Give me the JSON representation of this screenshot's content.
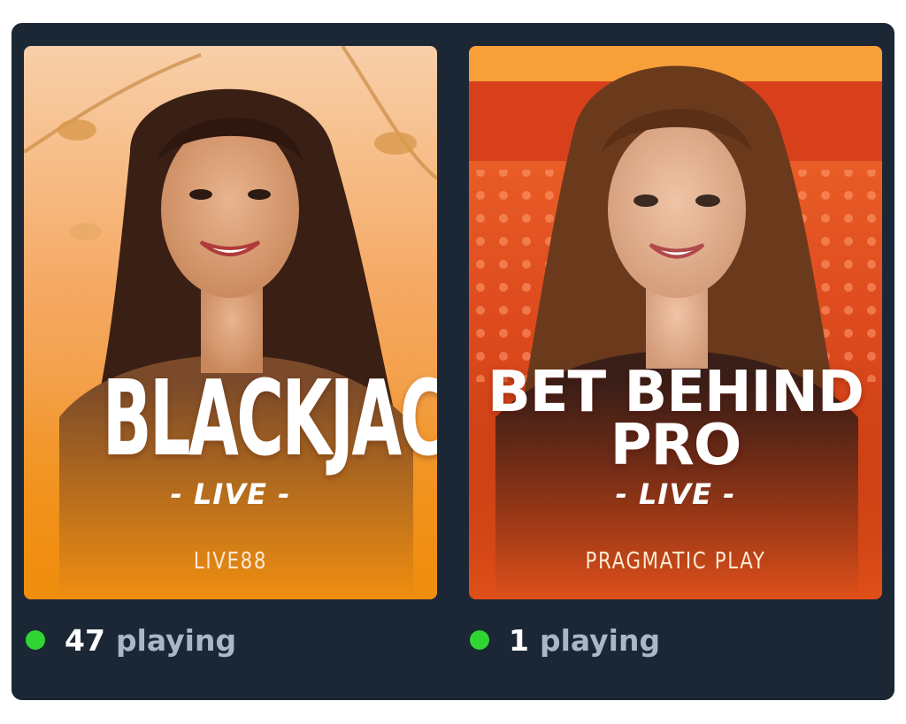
{
  "theme": {
    "panel_bg": "#1b2735",
    "online_color": "#2fd633"
  },
  "games": [
    {
      "title": "BLACKJACK",
      "subtitle": "- LIVE -",
      "provider": "LIVE88",
      "players_count": "47",
      "players_label": "playing",
      "art_colors": [
        "#f7c49a",
        "#f59a3c",
        "#f08a0a"
      ]
    },
    {
      "title_line1": "BET BEHIND",
      "title_line2": "PRO",
      "subtitle": "- LIVE -",
      "provider": "PRAGMATIC PLAY",
      "players_count": "1",
      "players_label": "playing",
      "art_colors": [
        "#f36a2c",
        "#d9401a",
        "#b8310f"
      ]
    }
  ]
}
